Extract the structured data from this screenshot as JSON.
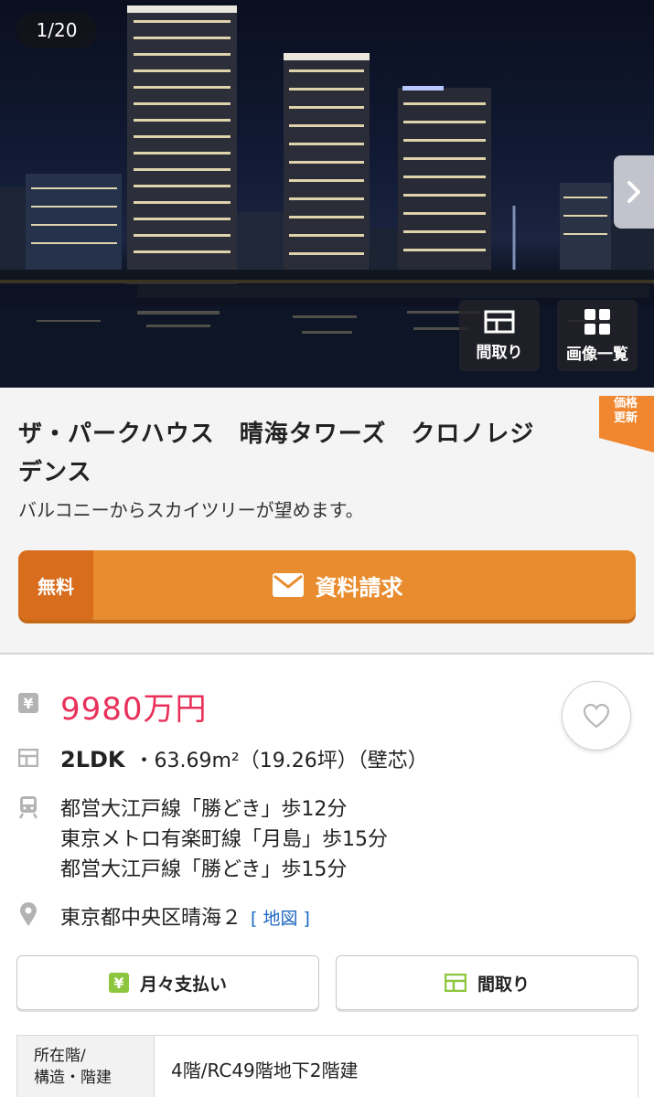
{
  "gallery": {
    "counter": "1/20",
    "floorplan_label": "間取り",
    "gallery_label": "画像一覧",
    "icons": {
      "next": "chevron-right-icon",
      "floorplan": "floorplan-icon",
      "gallery": "grid-icon"
    }
  },
  "property": {
    "badge": [
      "価格",
      "更新"
    ],
    "title_line1": "ザ・パークハウス　晴海タワーズ　クロノレジ",
    "title_line2": "デンス",
    "subtitle": "バルコニーからスカイツリーが望めます。",
    "request": {
      "free_label": "無料",
      "label": "資料請求",
      "icon": "mail-icon",
      "color": "#e98c2f"
    }
  },
  "details": {
    "price": "9980万円",
    "price_color": "#e8305a",
    "layout": "2LDK",
    "area": "・63.69m²（19.26坪）（壁芯）",
    "stations": [
      "都営大江戸線「勝どき」歩12分",
      "東京メトロ有楽町線「月島」歩15分",
      "都営大江戸線「勝どき」歩15分"
    ],
    "address": "東京都中央区晴海２",
    "map_link": "[ 地図 ]",
    "icons": {
      "price": "yen-icon",
      "layout": "floorplan-icon",
      "train": "train-icon",
      "location": "map-pin-icon",
      "favorite": "heart-icon"
    }
  },
  "actions": {
    "monthly_label": "月々支払い",
    "madori_label": "間取り",
    "accent": "#8cc63f"
  },
  "info": {
    "header_line1": "所在階/",
    "header_line2": "構造・階建",
    "value": "4階/RC49階地下2階建"
  }
}
